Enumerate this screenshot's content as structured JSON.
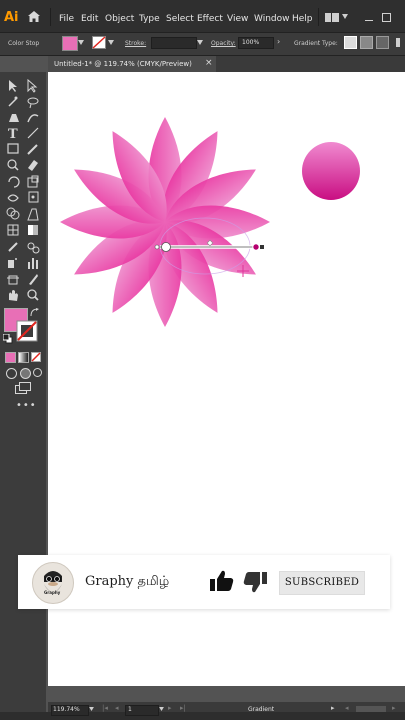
{
  "app": {
    "logo": "Ai"
  },
  "menu": [
    "File",
    "Edit",
    "Object",
    "Type",
    "Select",
    "Effect",
    "View",
    "Window",
    "Help"
  ],
  "control_bar": {
    "mode_label": "Color Stop",
    "stroke_label": "Stroke:",
    "opacity_label": "Opacity:",
    "opacity_value": "100%",
    "gradient_type_label": "Gradient Type:"
  },
  "document_tab": {
    "title": "Untitled-1* @ 119.74% (CMYK/Preview)",
    "close": "×"
  },
  "status": {
    "zoom": "119.74%",
    "artboard": "1",
    "tool": "Gradient"
  },
  "overlay": {
    "channel_name": "Graphy தமிழ்",
    "avatar_text": "Graphy",
    "subscribe_label": "SUBSCRIBED"
  },
  "colors": {
    "accent": "#e0359a",
    "fill_swatch": "#e86fb6",
    "dark": "#b5006f"
  }
}
